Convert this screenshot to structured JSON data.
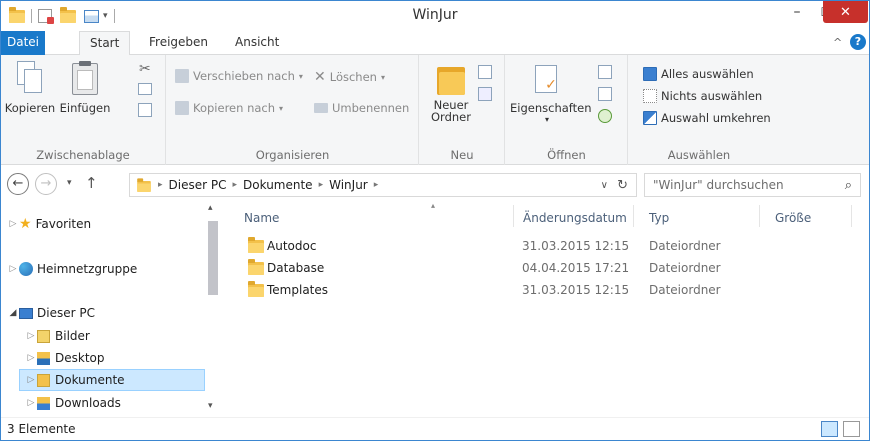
{
  "window": {
    "title": "WinJur",
    "minimize": "–",
    "maximize": "☐",
    "close": "✕"
  },
  "ribbon_tabs": [
    "Datei",
    "Start",
    "Freigeben",
    "Ansicht"
  ],
  "ribbon": {
    "clipboard": {
      "copy": "Kopieren",
      "paste": "Einfügen",
      "group": "Zwischenablage"
    },
    "organize": {
      "move_to": "Verschieben nach",
      "copy_to": "Kopieren nach",
      "delete": "Löschen",
      "rename": "Umbenennen",
      "group": "Organisieren"
    },
    "new": {
      "new_folder_line1": "Neuer",
      "new_folder_line2": "Ordner",
      "group": "Neu"
    },
    "open": {
      "properties": "Eigenschaften",
      "group": "Öffnen"
    },
    "select": {
      "select_all": "Alles auswählen",
      "select_none": "Nichts auswählen",
      "invert": "Auswahl umkehren",
      "group": "Auswählen"
    }
  },
  "address": {
    "crumbs": [
      "Dieser PC",
      "Dokumente",
      "WinJur"
    ],
    "search_placeholder": "\"WinJur\" durchsuchen"
  },
  "nav_pane": {
    "favorites": "Favoriten",
    "homegroup": "Heimnetzgruppe",
    "this_pc": "Dieser PC",
    "children": [
      "Bilder",
      "Desktop",
      "Dokumente",
      "Downloads"
    ]
  },
  "columns": [
    "Name",
    "Änderungsdatum",
    "Typ",
    "Größe"
  ],
  "files": [
    {
      "name": "Autodoc",
      "date": "31.03.2015 12:15",
      "type": "Dateiordner"
    },
    {
      "name": "Database",
      "date": "04.04.2015 17:21",
      "type": "Dateiordner"
    },
    {
      "name": "Templates",
      "date": "31.03.2015 12:15",
      "type": "Dateiordner"
    }
  ],
  "status": {
    "count": "3 Elemente"
  },
  "colors": {
    "accent": "#1979ca",
    "selection": "#cce8ff",
    "folder": "#f3c14a"
  }
}
